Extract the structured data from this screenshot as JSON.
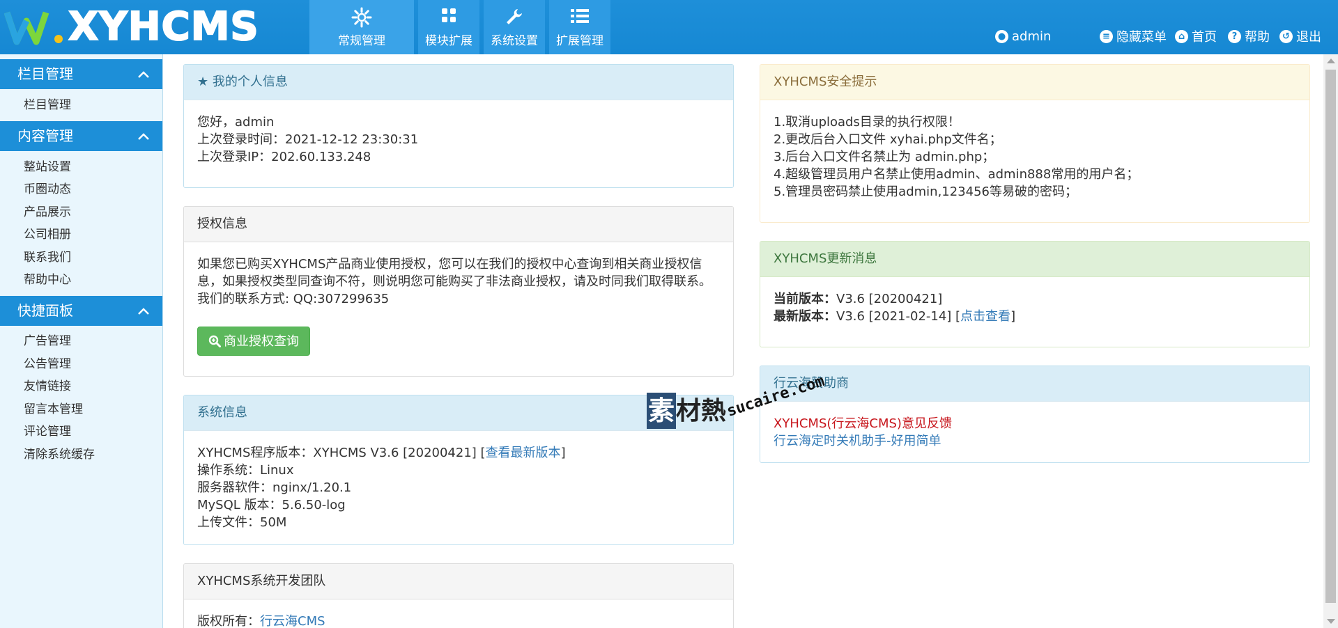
{
  "brand": {
    "logo_text": "XYHCMS"
  },
  "nav": {
    "tabs": [
      {
        "label": "常规管理",
        "icon": "gear-icon"
      },
      {
        "label": "模块扩展",
        "icon": "grid-icon"
      },
      {
        "label": "系统设置",
        "icon": "wrench-icon"
      },
      {
        "label": "扩展管理",
        "icon": "list-icon"
      }
    ]
  },
  "header": {
    "username": "admin",
    "links": [
      {
        "label": "隐藏菜单",
        "icon": "menu-icon"
      },
      {
        "label": "首页",
        "icon": "home-icon"
      },
      {
        "label": "帮助",
        "icon": "help-icon"
      },
      {
        "label": "退出",
        "icon": "logout-icon"
      }
    ]
  },
  "sidebar": {
    "groups": [
      {
        "title": "栏目管理",
        "items": [
          "栏目管理"
        ]
      },
      {
        "title": "内容管理",
        "items": [
          "整站设置",
          "币圈动态",
          "产品展示",
          "公司相册",
          "联系我们",
          "帮助中心"
        ]
      },
      {
        "title": "快捷面板",
        "items": [
          "广告管理",
          "公告管理",
          "友情链接",
          "留言本管理",
          "评论管理",
          "清除系统缓存"
        ]
      }
    ]
  },
  "profile": {
    "title": "★ 我的个人信息",
    "greeting": "您好，admin",
    "last_login_time": "上次登录时间：2021-12-12 23:30:31",
    "last_login_ip": "上次登录IP：202.60.133.248"
  },
  "license": {
    "title": "授权信息",
    "text": "如果您已购买XYHCMS产品商业使用授权，您可以在我们的授权中心查询到相关商业授权信息，如果授权类型同查询不符，则说明您可能购买了非法商业授权，请及时同我们取得联系。 我们的联系方式: QQ:307299635",
    "button": "商业授权查询"
  },
  "sysinfo": {
    "title": "系统信息",
    "version_prefix": "XYHCMS程序版本：XYHCMS V3.6 [20200421] [",
    "version_link": "查看最新版本",
    "version_suffix": "]",
    "os": "操作系统：Linux",
    "server": "服务器软件：nginx/1.20.1",
    "mysql": "MySQL 版本：5.6.50-log",
    "upload": "上传文件：50M"
  },
  "team": {
    "title": "XYHCMS系统开发团队",
    "copyright_label": "版权所有：",
    "copyright_link": "行云海CMS"
  },
  "security": {
    "title": "XYHCMS安全提示",
    "tips": [
      "1.取消uploads目录的执行权限！",
      "2.更改后台入口文件 xyhai.php文件名；",
      "3.后台入口文件名禁止为 admin.php；",
      "4.超级管理员用户名禁止使用admin、admin888常用的用户名；",
      "5.管理员密码禁止使用admin,123456等易破的密码；"
    ]
  },
  "update": {
    "title": "XYHCMS更新消息",
    "current_label": "当前版本：",
    "current_value": "V3.6 [20200421]",
    "latest_label": "最新版本：",
    "latest_value": "V3.6 [2021-02-14] [",
    "latest_link": "点击查看",
    "latest_suffix": "]"
  },
  "sponsor": {
    "title": "行云海赞助商",
    "link1": "XYHCMS(行云海CMS)意见反馈",
    "link2": "行云海定时关机助手-好用简单"
  },
  "watermark": {
    "badge": "素",
    "text": "材熱",
    "url": "sucaire.com"
  },
  "colors": {
    "primary": "#1688d3",
    "sidebar_bg": "#e9f6fd",
    "success": "#5cb85c",
    "link": "#337ab7",
    "alert_red": "#c7161c"
  }
}
